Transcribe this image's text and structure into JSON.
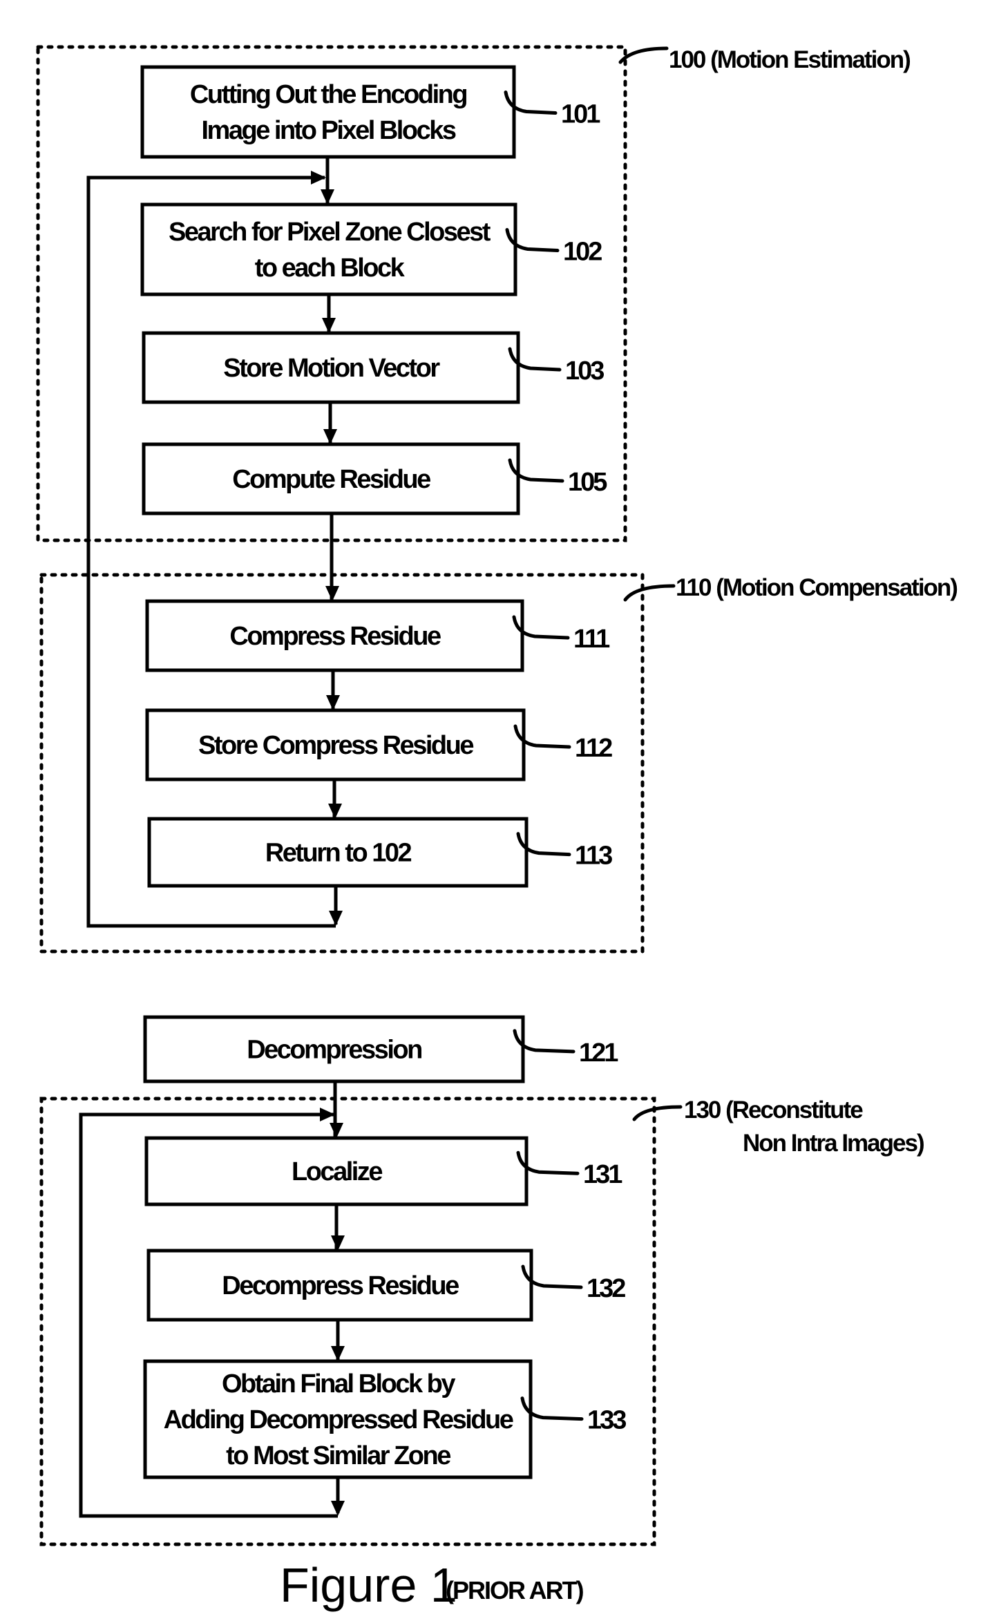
{
  "figure": {
    "caption": "Figure 1",
    "caption_note": "(PRIOR ART)"
  },
  "groups": {
    "motion_estimation": {
      "label": "100 (Motion Estimation)"
    },
    "motion_compensation": {
      "label": "110 (Motion Compensation)"
    },
    "reconstitute": {
      "label_lines": [
        "130 (Reconstitute",
        "Non Intra Images)"
      ]
    }
  },
  "steps": {
    "s101": {
      "ref": "101",
      "lines": [
        "Cutting Out the Encoding",
        "Image into Pixel Blocks"
      ]
    },
    "s102": {
      "ref": "102",
      "lines": [
        "Search for Pixel Zone Closest",
        "to each Block"
      ]
    },
    "s103": {
      "ref": "103",
      "lines": [
        "Store Motion Vector"
      ]
    },
    "s105": {
      "ref": "105",
      "lines": [
        "Compute Residue"
      ]
    },
    "s111": {
      "ref": "111",
      "lines": [
        "Compress Residue"
      ]
    },
    "s112": {
      "ref": "112",
      "lines": [
        "Store Compress Residue"
      ]
    },
    "s113": {
      "ref": "113",
      "lines": [
        "Return to 102"
      ]
    },
    "s121": {
      "ref": "121",
      "lines": [
        "Decompression"
      ]
    },
    "s131": {
      "ref": "131",
      "lines": [
        "Localize"
      ]
    },
    "s132": {
      "ref": "132",
      "lines": [
        "Decompress Residue"
      ]
    },
    "s133": {
      "ref": "133",
      "lines": [
        "Obtain Final Block by",
        "Adding Decompressed Residue",
        "to Most Similar Zone"
      ]
    }
  }
}
